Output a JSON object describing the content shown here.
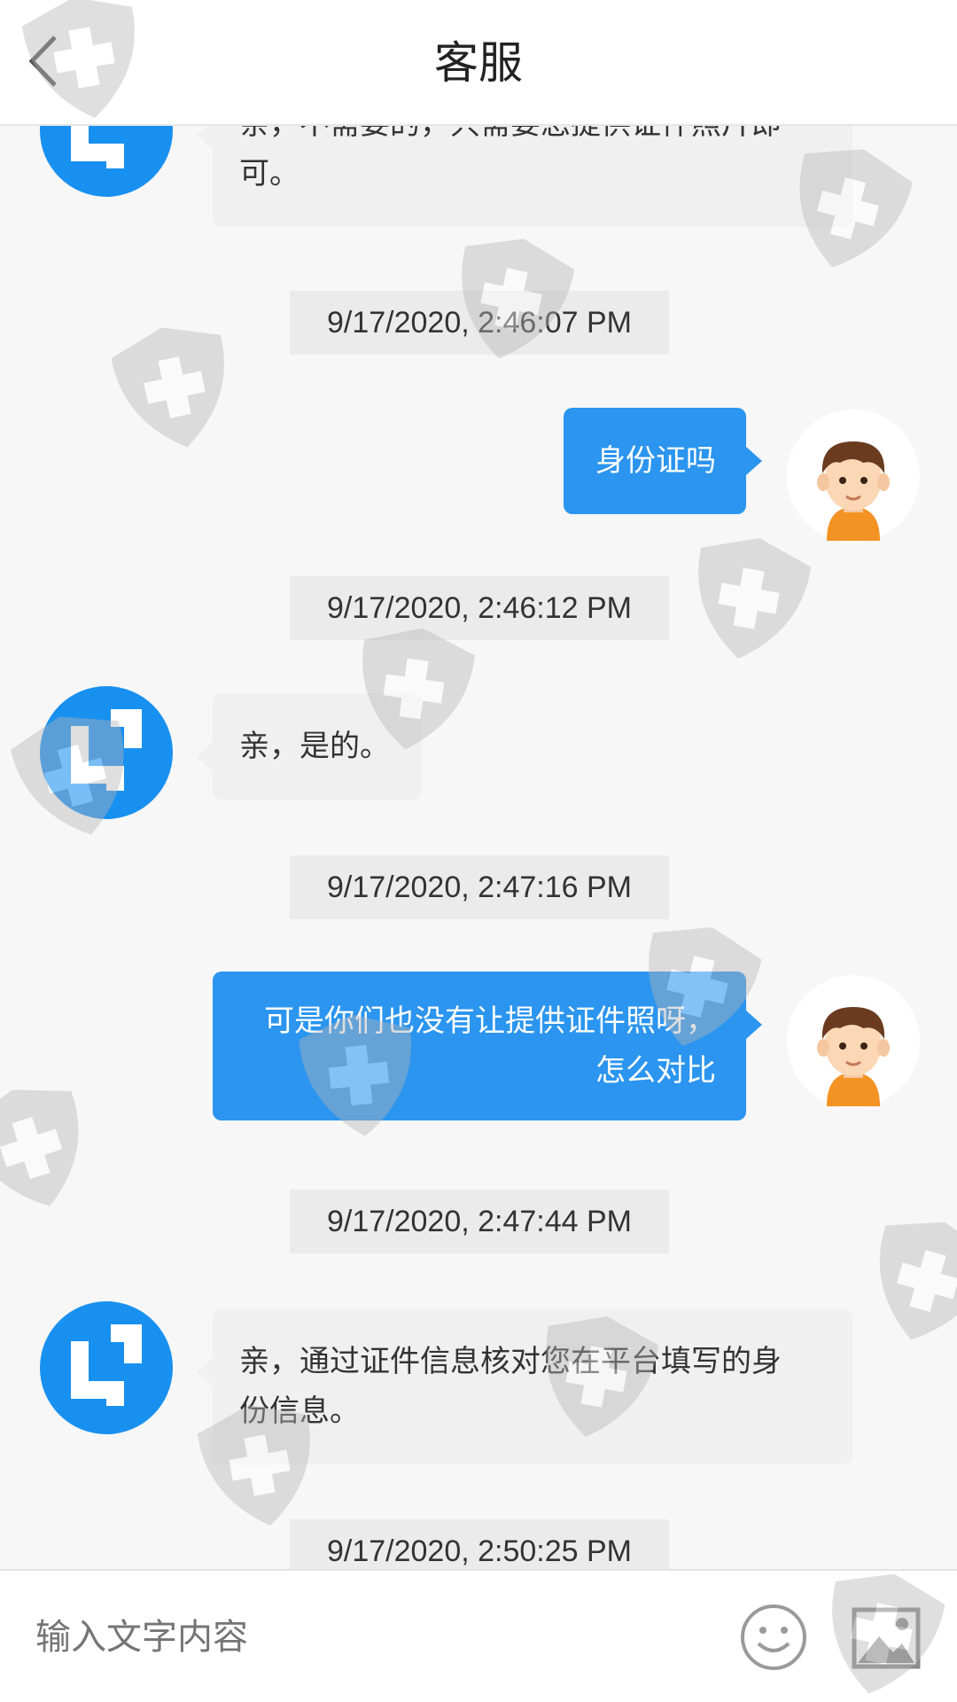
{
  "header": {
    "title": "客服"
  },
  "messages": [
    {
      "lines": [
        "亲，不需要的，只需要您提供证件照片即",
        "可。"
      ]
    },
    {
      "time": "9/17/2020, 2:46:07 PM"
    },
    {
      "text": "身份证吗"
    },
    {
      "time": "9/17/2020, 2:46:12 PM"
    },
    {
      "text": "亲，是的。"
    },
    {
      "time": "9/17/2020, 2:47:16 PM"
    },
    {
      "lines": [
        "可是你们也没有让提供证件照呀，",
        "怎么对比"
      ]
    },
    {
      "time": "9/17/2020, 2:47:44 PM"
    },
    {
      "lines": [
        "亲，通过证件信息核对您在平台填写的身",
        "份信息。"
      ]
    },
    {
      "time": "9/17/2020, 2:50:25 PM"
    }
  ],
  "input": {
    "placeholder": "输入文字内容"
  },
  "icons": {
    "back": "back-arrow-icon",
    "cs_avatar": "customer-service-logo",
    "user_avatar": "boy-avatar",
    "emoji": "smiley-icon",
    "image": "image-icon"
  },
  "colors": {
    "accent": "#2b95ef",
    "cs_logo": "#1890f0"
  }
}
